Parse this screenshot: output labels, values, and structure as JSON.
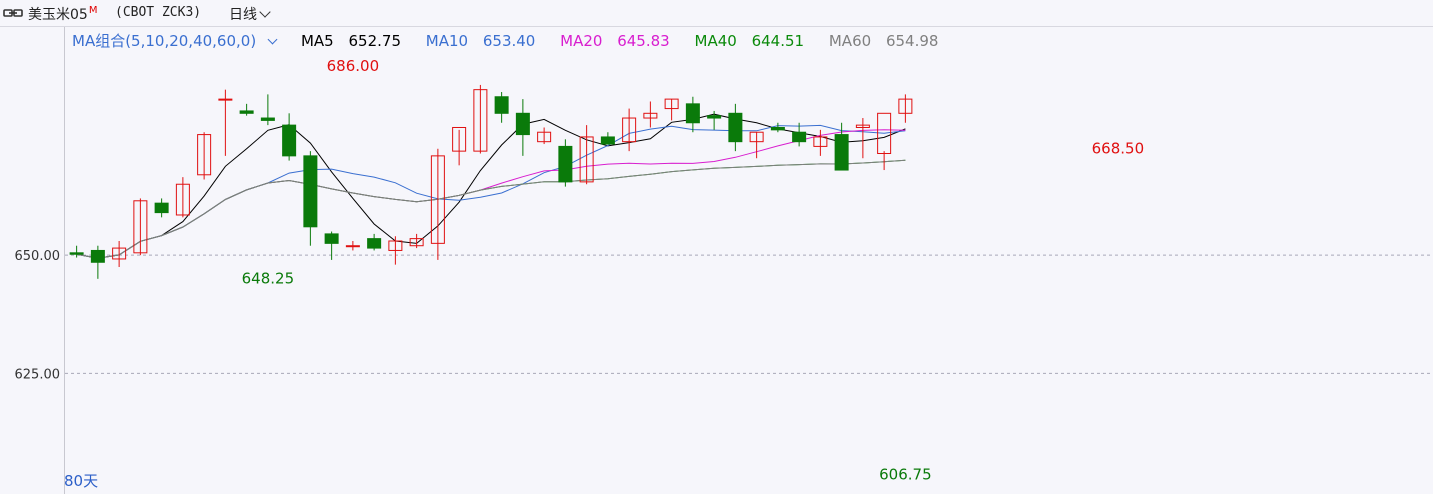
{
  "header": {
    "instrument_name": "美玉米05",
    "instrument_badge": "M",
    "code": "(CBOT ZCK3)",
    "period": "日线",
    "link_icon": "chain-link-icon"
  },
  "legend": {
    "combo": "MA组合(5,10,20,40,60,0)",
    "items": [
      {
        "name": "MA5",
        "value": "652.75",
        "color": "#000000"
      },
      {
        "name": "MA10",
        "value": "653.40",
        "color": "#3a6fd0"
      },
      {
        "name": "MA20",
        "value": "645.83",
        "color": "#d81ecf"
      },
      {
        "name": "MA40",
        "value": "644.51",
        "color": "#0b8a0b"
      },
      {
        "name": "MA60",
        "value": "654.98",
        "color": "#808080"
      }
    ]
  },
  "footer": {
    "bars_label": "80天"
  },
  "colors": {
    "up": "#e01010",
    "down": "#0a7a0a",
    "grid": "#a8a8b8",
    "background": "#f6f6fb"
  },
  "chart_data": {
    "type": "candlestick",
    "ylim": [
      599.5,
      695.5
    ],
    "yticks": [
      {
        "value": 625,
        "label": "625.00"
      },
      {
        "value": 650,
        "label": "650.00"
      }
    ],
    "annotations": [
      {
        "index": 13,
        "value": 686.0,
        "label": "686.00",
        "pos": "above",
        "color": "#e01010"
      },
      {
        "index": 9,
        "value": 648.25,
        "label": "648.25",
        "pos": "below",
        "color": "#0a7a0a"
      },
      {
        "index": 39,
        "value": 606.75,
        "label": "606.75",
        "pos": "below",
        "color": "#0a7a0a"
      },
      {
        "index": 49,
        "value": 668.5,
        "label": "668.50",
        "pos": "above",
        "color": "#e01010"
      }
    ],
    "candles": [
      {
        "o": 650.5,
        "h": 652.0,
        "l": 649.5,
        "c": 650.2
      },
      {
        "o": 651.0,
        "h": 652.0,
        "l": 645.0,
        "c": 648.5
      },
      {
        "o": 649.2,
        "h": 653.0,
        "l": 647.5,
        "c": 651.5
      },
      {
        "o": 650.5,
        "h": 662.0,
        "l": 650.0,
        "c": 661.5
      },
      {
        "o": 661.0,
        "h": 662.0,
        "l": 658.0,
        "c": 659.0
      },
      {
        "o": 658.5,
        "h": 666.5,
        "l": 658.0,
        "c": 665.0
      },
      {
        "o": 667.0,
        "h": 676.0,
        "l": 666.0,
        "c": 675.5
      },
      {
        "o": 683.0,
        "h": 685.0,
        "l": 671.0,
        "c": 683.0
      },
      {
        "o": 680.5,
        "h": 682.0,
        "l": 679.5,
        "c": 680.0
      },
      {
        "o": 679.0,
        "h": 684.0,
        "l": 677.5,
        "c": 678.5
      },
      {
        "o": 677.5,
        "h": 680.0,
        "l": 670.0,
        "c": 671.0
      },
      {
        "o": 671.0,
        "h": 672.0,
        "l": 652.0,
        "c": 656.0
      },
      {
        "o": 654.5,
        "h": 655.0,
        "l": 649.0,
        "c": 652.5
      },
      {
        "o": 652.0,
        "h": 653.0,
        "l": 651.0,
        "c": 652.0
      },
      {
        "o": 653.5,
        "h": 654.5,
        "l": 651.0,
        "c": 651.5
      },
      {
        "o": 651.0,
        "h": 654.0,
        "l": 648.0,
        "c": 653.0
      },
      {
        "o": 652.0,
        "h": 654.5,
        "l": 651.5,
        "c": 653.5
      },
      {
        "o": 652.5,
        "h": 672.5,
        "l": 649.0,
        "c": 671.0
      },
      {
        "o": 672.0,
        "h": 676.5,
        "l": 669.0,
        "c": 677.0
      },
      {
        "o": 672.0,
        "h": 686.0,
        "l": 671.5,
        "c": 685.0
      },
      {
        "o": 683.5,
        "h": 684.5,
        "l": 678.0,
        "c": 680.0
      },
      {
        "o": 680.0,
        "h": 683.0,
        "l": 671.0,
        "c": 675.5
      },
      {
        "o": 674.0,
        "h": 677.0,
        "l": 673.5,
        "c": 676.0
      },
      {
        "o": 673.0,
        "h": 674.5,
        "l": 664.5,
        "c": 665.5
      },
      {
        "o": 665.5,
        "h": 677.5,
        "l": 665.0,
        "c": 675.0
      },
      {
        "o": 675.0,
        "h": 676.0,
        "l": 673.5,
        "c": 673.5
      },
      {
        "o": 674.0,
        "h": 681.0,
        "l": 672.0,
        "c": 679.0
      },
      {
        "o": 679.0,
        "h": 682.5,
        "l": 677.0,
        "c": 680.0
      },
      {
        "o": 681.0,
        "h": 683.0,
        "l": 678.5,
        "c": 683.0
      },
      {
        "o": 682.0,
        "h": 683.5,
        "l": 676.0,
        "c": 678.0
      },
      {
        "o": 679.5,
        "h": 680.5,
        "l": 676.5,
        "c": 679.0
      },
      {
        "o": 680.0,
        "h": 682.0,
        "l": 672.0,
        "c": 674.0
      },
      {
        "o": 674.0,
        "h": 676.0,
        "l": 670.5,
        "c": 676.0
      },
      {
        "o": 677.0,
        "h": 678.0,
        "l": 676.0,
        "c": 676.5
      },
      {
        "o": 676.0,
        "h": 678.0,
        "l": 673.0,
        "c": 674.0
      },
      {
        "o": 673.0,
        "h": 676.5,
        "l": 671.0,
        "c": 675.0
      },
      {
        "o": 675.5,
        "h": 678.0,
        "l": 669.5,
        "c": 668.0
      },
      {
        "o": 677.0,
        "h": 679.0,
        "l": 670.5,
        "c": 677.5
      },
      {
        "o": 671.5,
        "h": 672.0,
        "l": 668.0,
        "c": 680.0
      },
      {
        "o": 680.0,
        "h": 684.0,
        "l": 678.0,
        "c": 683.0
      }
    ]
  }
}
